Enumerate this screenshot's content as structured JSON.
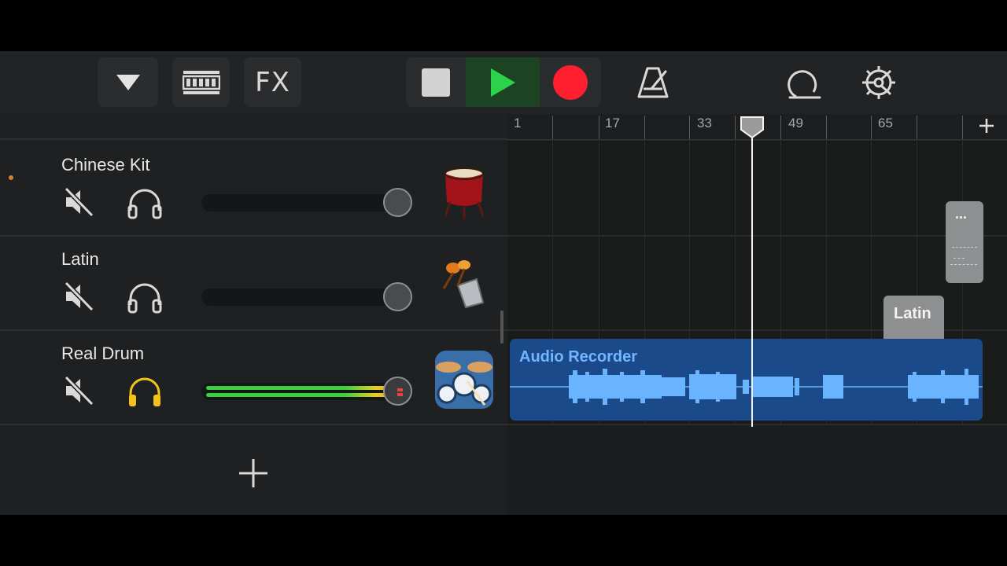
{
  "toolbar": {
    "fx_label": "FX",
    "icons": {
      "dropdown": "triangle-down-icon",
      "tracks_view": "tracks-view-icon",
      "stop": "stop-icon",
      "play": "play-icon",
      "record": "record-icon",
      "metronome": "metronome-icon",
      "loop": "loop-browser-icon",
      "settings": "gear-icon"
    },
    "colors": {
      "play": "#2bd24a",
      "record": "#ff1f2e"
    }
  },
  "tracks": [
    {
      "name": "Chinese Kit",
      "instrument_icon": "chinese-drum-icon",
      "solo_active": false
    },
    {
      "name": "Latin",
      "instrument_icon": "maracas-cowbell-icon",
      "solo_active": false
    },
    {
      "name": "Real Drum",
      "instrument_icon": "drum-kit-icon",
      "solo_active": true
    }
  ],
  "ruler": {
    "labels": [
      "1",
      "17",
      "33",
      "49",
      "65"
    ]
  },
  "regions": {
    "chinese_kit": {
      "title": "..."
    },
    "latin": {
      "title": "Latin"
    },
    "audio": {
      "title": "Audio Recorder"
    }
  },
  "colors": {
    "solo_active": "#f0c419",
    "audio_region": "#1a4a8a",
    "waveform": "#6ab4ff",
    "region_grey": "#8e8f91"
  }
}
